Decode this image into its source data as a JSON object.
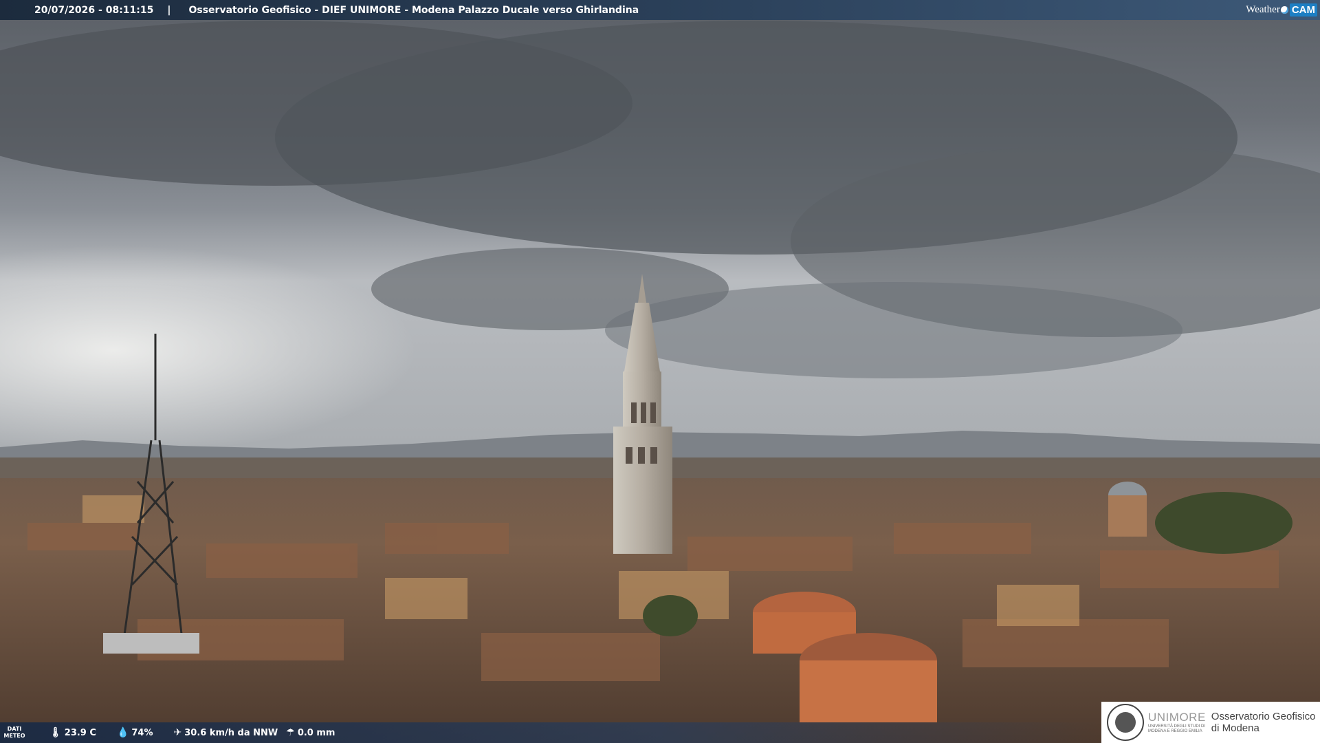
{
  "header": {
    "datetime": "20/07/2026 - 08:11:15",
    "separator": "|",
    "title": "Osservatorio Geofisico - DIEF UNIMORE - Modena Palazzo Ducale verso Ghirlandina"
  },
  "brand": {
    "weather": "Weather",
    "cam": "CAM"
  },
  "weather": {
    "label_line1": "DATI",
    "label_line2": "METEO",
    "temperature": "23.9 C",
    "humidity": "74%",
    "wind": "30.6 km/h da NNW",
    "rain": "0.0 mm"
  },
  "footer_logo": {
    "unimore": "UNIMORE",
    "uni_sub1": "UNIVERSITÀ DEGLI STUDI DI",
    "uni_sub2": "MODENA E REGGIO EMILIA",
    "osservatorio_line1": "Osservatorio Geofisico",
    "osservatorio_line2": "di Modena"
  },
  "icons": {
    "temperature": "thermometer-icon",
    "humidity": "droplet-icon",
    "wind": "wind-icon",
    "rain": "rain-icon"
  }
}
